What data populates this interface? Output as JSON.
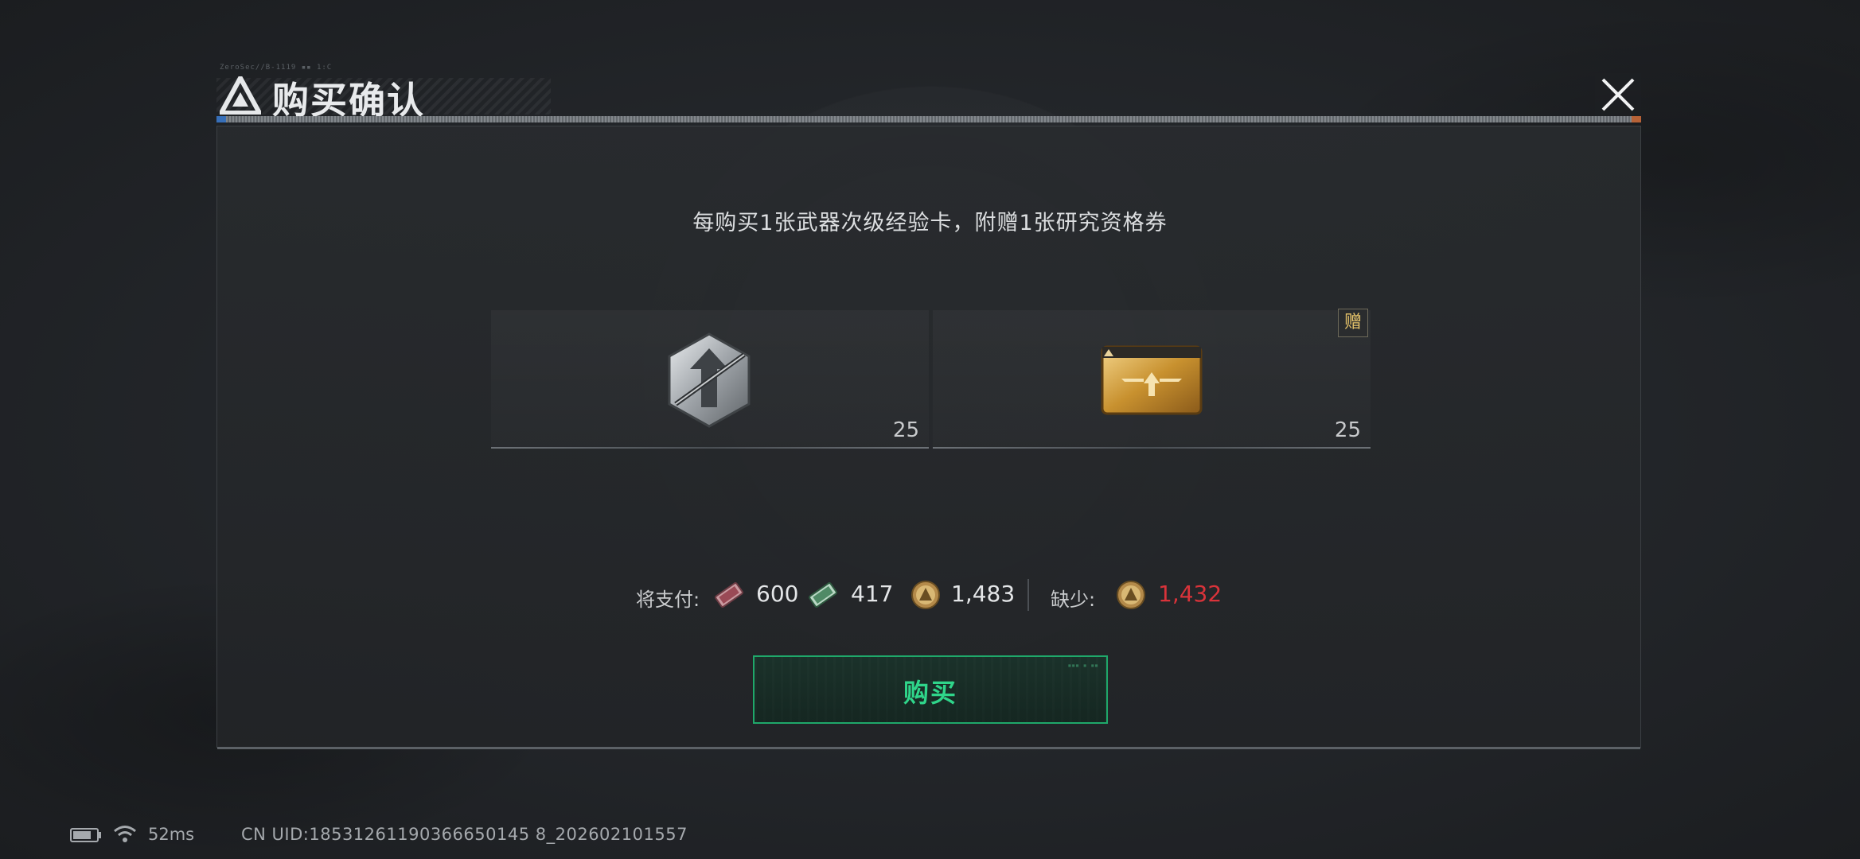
{
  "dialog": {
    "title": "购买确认",
    "header_code": "ZeroSec//B-1119 ▪▪ 1:C",
    "subtitle": "每购买1张武器次级经验卡，附赠1张研究资格券"
  },
  "items": [
    {
      "name": "武器次级经验卡",
      "icon": "weapon-exp-card-icon",
      "quantity": "25"
    },
    {
      "name": "研究资格券",
      "icon": "research-voucher-icon",
      "quantity": "25",
      "badge": "赠"
    }
  ],
  "payment": {
    "pay_label": "将支付:",
    "costs": [
      {
        "icon": "red-ticket-currency-icon",
        "amount": "600"
      },
      {
        "icon": "green-cash-currency-icon",
        "amount": "417"
      },
      {
        "icon": "gold-coin-currency-icon",
        "amount": "1,483"
      }
    ],
    "shortage_label": "缺少:",
    "shortage": {
      "icon": "gold-coin-currency-icon",
      "amount": "1,432"
    }
  },
  "buy_button": {
    "label": "购买"
  },
  "status_bar": {
    "ping": "52ms",
    "uid": "CN UID:18531261190366650145 8_202602101557"
  },
  "colors": {
    "accent_green": "#2fd58a",
    "shortage_red": "#d9333a",
    "gift_gold": "#e6c36a"
  }
}
